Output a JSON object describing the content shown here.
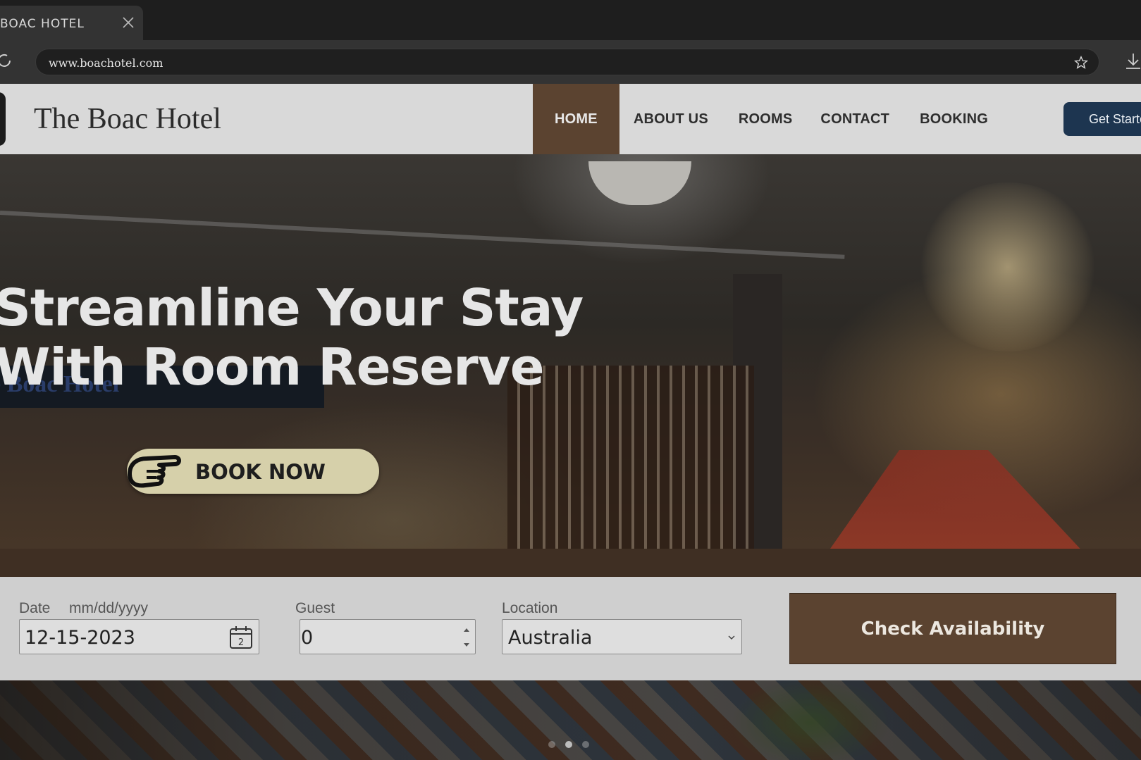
{
  "browser": {
    "tab_title": "BOAC HOTEL",
    "url": "www.boachotel.com"
  },
  "header": {
    "brand": "The Boac Hotel",
    "nav": [
      "HOME",
      "ABOUT US",
      "ROOMS",
      "CONTACT",
      "BOOKING"
    ],
    "active_nav": "HOME",
    "cta_label": "Get Started"
  },
  "hero": {
    "headline_line1": "Streamline Your Stay",
    "headline_line2": "With Room Reserve",
    "sign_text": "e Boac Hotel",
    "book_now_label": "BOOK NOW"
  },
  "booking": {
    "date_label": "Date",
    "date_format_hint": "mm/dd/yyyy",
    "date_value": "12-15-2023",
    "calendar_day": "2",
    "guest_label": "Guest",
    "guest_value": "0",
    "location_label": "Location",
    "location_value": "Australia",
    "check_label": "Check Availability"
  },
  "carousel": {
    "current_slide": 2,
    "total_slides": 3
  },
  "colors": {
    "accent_brown": "#5b4330",
    "cta_navy": "#1d3550",
    "book_now_bg": "#d6d0aa"
  }
}
